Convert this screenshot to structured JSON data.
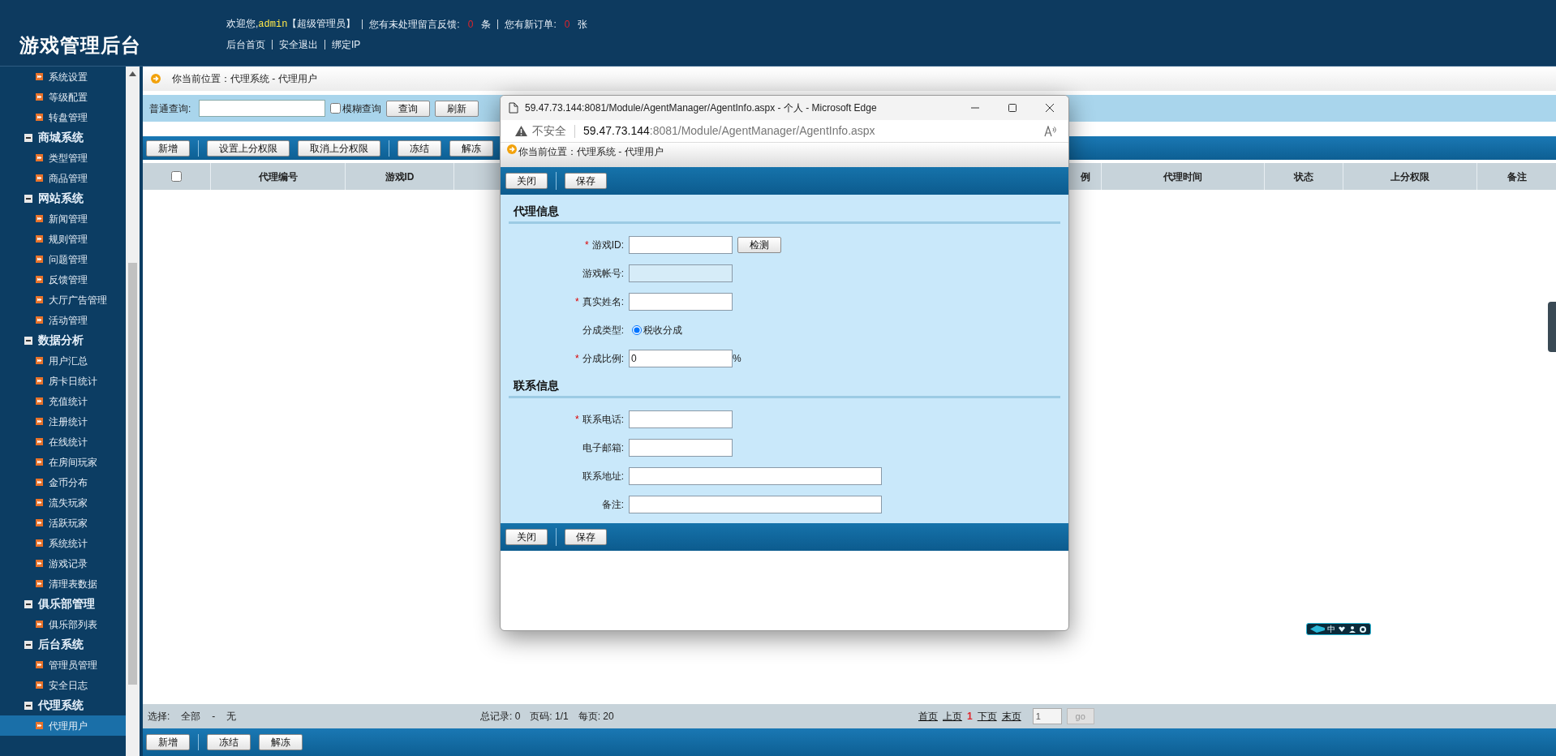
{
  "header": {
    "title": "游戏管理后台",
    "greeting": "欢迎您,",
    "user": "admin",
    "role": "【超级管理员】",
    "feedback_label": "您有未处理留言反馈:",
    "feedback_count": "0",
    "feedback_unit": "条",
    "orders_label": "您有新订单:",
    "orders_count": "0",
    "orders_unit": "张",
    "links": [
      "后台首页",
      "安全退出",
      "绑定IP"
    ]
  },
  "sidebar": {
    "groups": [
      {
        "children": [
          {
            "label": "系统设置",
            "selected": false
          },
          {
            "label": "等级配置",
            "selected": false
          },
          {
            "label": "转盘管理",
            "selected": false
          }
        ]
      },
      {
        "title": "商城系统",
        "children": [
          {
            "label": "类型管理",
            "selected": false
          },
          {
            "label": "商品管理",
            "selected": false
          }
        ]
      },
      {
        "title": "网站系统",
        "children": [
          {
            "label": "新闻管理",
            "selected": false
          },
          {
            "label": "规则管理",
            "selected": false
          },
          {
            "label": "问题管理",
            "selected": false
          },
          {
            "label": "反馈管理",
            "selected": false
          },
          {
            "label": "大厅广告管理",
            "selected": false
          },
          {
            "label": "活动管理",
            "selected": false
          }
        ]
      },
      {
        "title": "数据分析",
        "children": [
          {
            "label": "用户汇总",
            "selected": false
          },
          {
            "label": "房卡日统计",
            "selected": false
          },
          {
            "label": "充值统计",
            "selected": false
          },
          {
            "label": "注册统计",
            "selected": false
          },
          {
            "label": "在线统计",
            "selected": false
          },
          {
            "label": "在房间玩家",
            "selected": false
          },
          {
            "label": "金币分布",
            "selected": false
          },
          {
            "label": "流失玩家",
            "selected": false
          },
          {
            "label": "活跃玩家",
            "selected": false
          },
          {
            "label": "系统统计",
            "selected": false
          },
          {
            "label": "游戏记录",
            "selected": false
          },
          {
            "label": "清理表数据",
            "selected": false
          }
        ]
      },
      {
        "title": "俱乐部管理",
        "children": [
          {
            "label": "俱乐部列表",
            "selected": false
          }
        ]
      },
      {
        "title": "后台系统",
        "children": [
          {
            "label": "管理员管理",
            "selected": false
          },
          {
            "label": "安全日志",
            "selected": false
          }
        ]
      },
      {
        "title": "代理系统",
        "children": [
          {
            "label": "代理用户",
            "selected": true
          }
        ]
      }
    ]
  },
  "main": {
    "breadcrumb": "你当前位置：代理系统 - 代理用户",
    "search": {
      "label": "普通查询:",
      "fuzzy": {
        "label": "模糊查询",
        "checked": false
      },
      "buttons": [
        "查询",
        "刷新"
      ]
    },
    "toolbar": [
      "新增",
      "设置上分权限",
      "取消上分权限",
      "冻结",
      "解冻"
    ],
    "table": {
      "select_all": {
        "checked": false
      },
      "columns_left": [
        "代理编号",
        "游戏ID"
      ],
      "columns_right": [
        "例",
        "代理时间",
        "状态",
        "上分权限",
        "备注"
      ]
    },
    "footer": {
      "select_label": "选择:",
      "select_all": "全部",
      "separator": "-",
      "select_none": "无",
      "total": "总记录: 0",
      "page": "页码: 1/1",
      "per_page": "每页: 20",
      "pager": [
        {
          "label": "首页",
          "kind": "link"
        },
        {
          "label": "上页",
          "kind": "link"
        },
        {
          "label": "1",
          "kind": "current"
        },
        {
          "label": "下页",
          "kind": "link"
        },
        {
          "label": "末页",
          "kind": "link"
        }
      ],
      "page_input": "1",
      "go": "go"
    },
    "bottom_buttons": [
      "新增",
      "冻结",
      "解冻"
    ]
  },
  "popup": {
    "title": "59.47.73.144:8081/Module/AgentManager/AgentInfo.aspx - 个人 - Microsoft Edge",
    "security": "不安全",
    "url_host": "59.47.73.144",
    "url_rest": ":8081/Module/AgentManager/AgentInfo.aspx",
    "breadcrumb": "你当前位置：代理系统 - 代理用户",
    "top_buttons": [
      "关闭",
      "保存"
    ],
    "sections": [
      {
        "title": "代理信息",
        "fields": [
          {
            "kind": "text",
            "label": "游戏ID:",
            "required_mark": "*",
            "button": "检测"
          },
          {
            "kind": "readonly",
            "label": "游戏帐号:"
          },
          {
            "kind": "text",
            "label": "真实姓名:",
            "required_mark": "*"
          },
          {
            "kind": "radio",
            "label": "分成类型:",
            "options": [
              {
                "label": "税收分成",
                "selected": true
              }
            ]
          },
          {
            "kind": "text",
            "label": "分成比例:",
            "required_mark": "*",
            "value": "0",
            "suffix": "%"
          }
        ]
      },
      {
        "title": "联系信息",
        "fields": [
          {
            "kind": "text",
            "label": "联系电话:",
            "required_mark": "*"
          },
          {
            "kind": "text",
            "label": "电子邮箱:"
          },
          {
            "kind": "wide",
            "label": "联系地址:"
          },
          {
            "kind": "wide",
            "label": "备注:"
          }
        ]
      }
    ],
    "bottom_buttons": [
      "关闭",
      "保存"
    ]
  },
  "ime_bar": {
    "label": "中"
  }
}
